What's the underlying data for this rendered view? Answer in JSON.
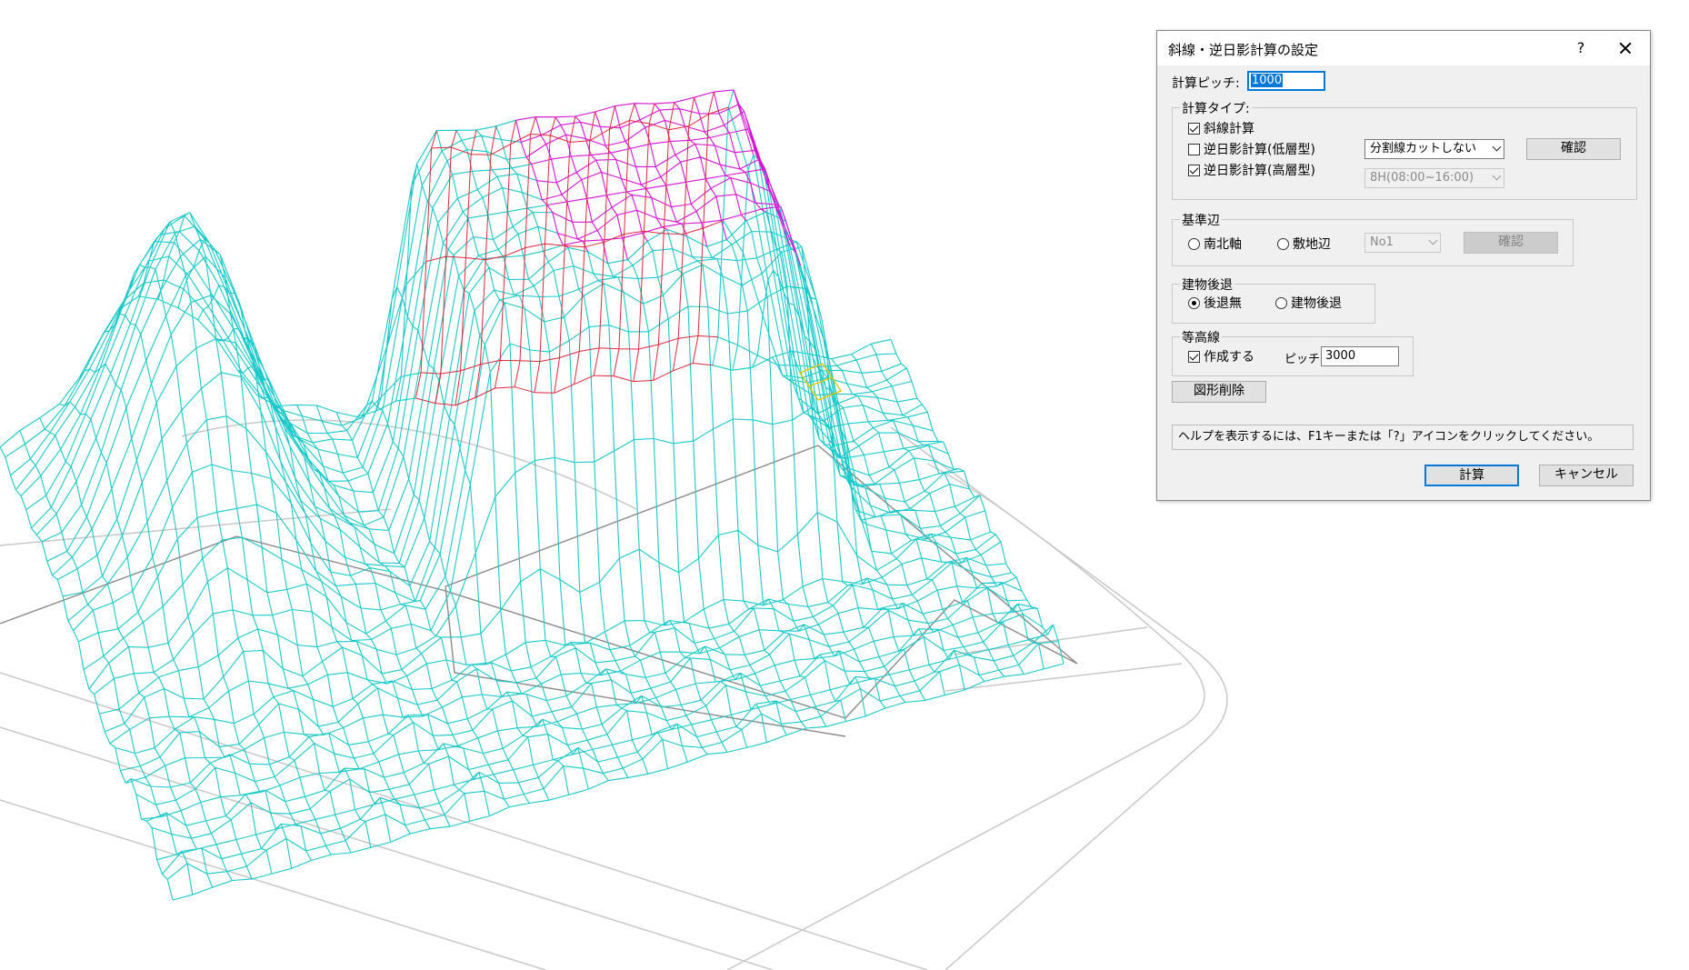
{
  "dialog": {
    "title": "斜線・逆日影計算の設定",
    "help_button": "?",
    "pitch_label": "計算ピッチ:",
    "pitch_value": "1000",
    "calc_type": {
      "title": "計算タイプ:",
      "slope_calc": {
        "label": "斜線計算",
        "checked": true
      },
      "inverse_low": {
        "label": "逆日影計算(低層型)",
        "checked": false
      },
      "inverse_high": {
        "label": "逆日影計算(高層型)",
        "checked": true
      },
      "split_select": "分割線カットしない",
      "time_select": "8H(08:00~16:00)",
      "confirm_button": "確認"
    },
    "base_edge": {
      "title": "基準辺",
      "option_ns": "南北軸",
      "option_site": "敷地辺",
      "selected": "",
      "edge_select": "No1",
      "confirm_button": "確認"
    },
    "setback": {
      "title": "建物後退",
      "option_none": "後退無",
      "option_setback": "建物後退",
      "selected": "後退無"
    },
    "contour": {
      "title": "等高線",
      "create_label": "作成する",
      "create_checked": true,
      "pitch_label": "ピッチ",
      "pitch_value": "3000"
    },
    "delete_button": "図形削除",
    "status_text": "ヘルプを表示するには、F1キーまたは「?」アイコンをクリックしてください。",
    "calc_button": "計算",
    "cancel_button": "キャンセル"
  },
  "colors": {
    "mesh_main": "#19c9c9",
    "mesh_roof_top": "#e0283c",
    "mesh_roof_face": "#d413d4",
    "mesh_highlight": "#e6c800",
    "site_outline": "#7a7a7a",
    "road_lines": "#c8c8c8"
  }
}
